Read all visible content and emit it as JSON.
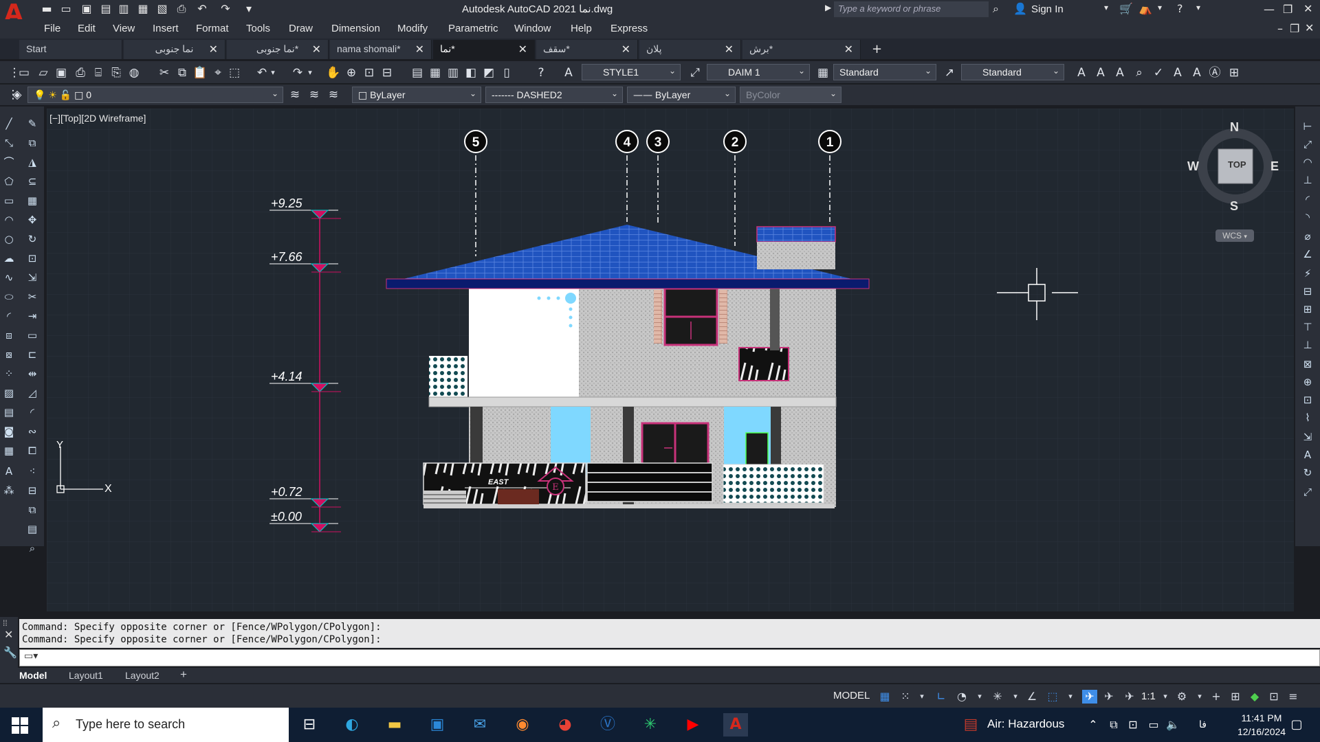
{
  "app": {
    "title": "Autodesk AutoCAD 2021  نما.dwg",
    "logo_letter": "A",
    "search_placeholder": "Type a keyword or phrase",
    "sign_in": "Sign In"
  },
  "menu": [
    "File",
    "Edit",
    "View",
    "Insert",
    "Format",
    "Tools",
    "Draw",
    "Dimension",
    "Modify",
    "Parametric",
    "Window",
    "Help",
    "Express"
  ],
  "tabs": [
    {
      "label": "Start",
      "active": false,
      "closable": false
    },
    {
      "label": "نما جنوبی",
      "active": false,
      "closable": true
    },
    {
      "label": "نما جنوبی*",
      "active": false,
      "closable": true
    },
    {
      "label": "nama shomali*",
      "active": false,
      "closable": true
    },
    {
      "label": "نما*",
      "active": true,
      "closable": true
    },
    {
      "label": "سقف*",
      "active": false,
      "closable": true
    },
    {
      "label": "پلان",
      "active": false,
      "closable": true
    },
    {
      "label": "برش*",
      "active": false,
      "closable": true
    }
  ],
  "toolbar1": {
    "text_style": "STYLE1",
    "dim_style": "DAIM 1",
    "table_style": "Standard",
    "mleader_style": "Standard"
  },
  "toolbar2": {
    "layer": "0",
    "color": "ByLayer",
    "linetype": "-------  DASHED2",
    "lineweight": "ByLayer",
    "plot_style": "ByColor"
  },
  "viewport": {
    "label": "[−][Top][2D Wireframe]",
    "viewcube": {
      "top": "TOP",
      "n": "N",
      "s": "S",
      "e": "E",
      "w": "W",
      "wcs": "WCS"
    }
  },
  "drawing": {
    "grid_markers": [
      "5",
      "4",
      "3",
      "2",
      "1"
    ],
    "levels": [
      "+9.25",
      "+7.66",
      "+4.14",
      "+0.72",
      "±0.00"
    ],
    "view_title": "EAST",
    "view_symbol": "E",
    "ucs": {
      "x": "X",
      "y": "Y"
    },
    "colors": {
      "roof": "#1f4fb5",
      "roof_eave": "#0a1b6e",
      "wall": "#cfcfcf",
      "white_wall": "#ffffff",
      "glass": "#7fd8ff",
      "frame": "#c8327a",
      "dark": "#1a1a1a",
      "dim_line": "#d01060"
    }
  },
  "command": {
    "history": [
      "Command: Specify opposite corner or [Fence/WPolygon/CPolygon]:",
      "Command: Specify opposite corner or [Fence/WPolygon/CPolygon]:"
    ],
    "input": ""
  },
  "layouts": [
    {
      "label": "Model",
      "active": true
    },
    {
      "label": "Layout1",
      "active": false
    },
    {
      "label": "Layout2",
      "active": false
    }
  ],
  "status": {
    "model": "MODEL",
    "scale": "1:1"
  },
  "taskbar": {
    "search_placeholder": "Type here to search",
    "weather": "Air: Hazardous",
    "time": "11:41 PM",
    "date": "12/16/2024",
    "lang": "فا"
  }
}
